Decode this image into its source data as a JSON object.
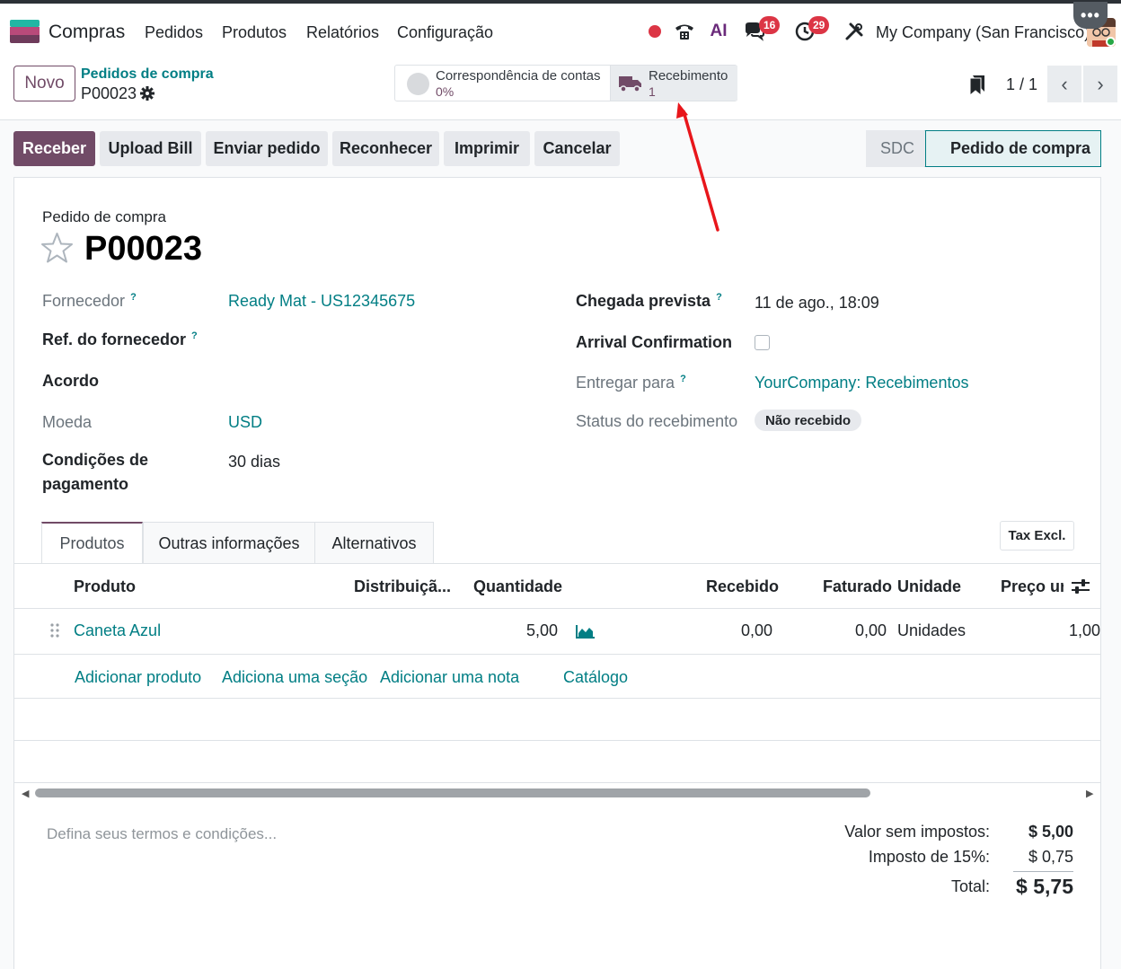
{
  "nav": {
    "app": "Compras",
    "menu": [
      "Pedidos",
      "Produtos",
      "Relatórios",
      "Configuração"
    ],
    "badges": {
      "messages": "16",
      "activities": "29"
    },
    "company": "My Company (San Francisco)",
    "ai_label": "AI"
  },
  "control": {
    "new_button": "Novo",
    "breadcrumb_parent": "Pedidos de compra",
    "breadcrumb_current": "P00023",
    "smart_match_title": "Correspondência de contas",
    "smart_match_value": "0%",
    "smart_receipt_title": "Recebimento",
    "smart_receipt_value": "1",
    "pager": "1 / 1"
  },
  "actions": {
    "buttons": [
      "Receber",
      "Upload Bill",
      "Enviar pedido",
      "Reconhecer",
      "Imprimir",
      "Cancelar"
    ],
    "status": [
      "SDC",
      "Pedido de compra"
    ]
  },
  "form": {
    "doc_label": "Pedido de compra",
    "doc_name": "P00023",
    "left": {
      "vendor_label": "Fornecedor",
      "vendor_value": "Ready Mat - US12345675",
      "vendor_ref_label": "Ref. do fornecedor",
      "agreement_label": "Acordo",
      "currency_label": "Moeda",
      "currency_value": "USD",
      "payment_terms_label_1": "Condições de",
      "payment_terms_label_2": "pagamento",
      "payment_terms_value": "30 dias"
    },
    "right": {
      "expected_label": "Chegada prevista",
      "expected_value": "11 de ago., 18:09",
      "arrival_confirm_label": "Arrival Confirmation",
      "deliver_to_label": "Entregar para",
      "deliver_to_value": "YourCompany: Recebimentos",
      "receipt_status_label": "Status do recebimento",
      "receipt_status_value": "Não recebido"
    },
    "help_mark": "?"
  },
  "tabs": [
    "Produtos",
    "Outras informações",
    "Alternativos"
  ],
  "tax_button": "Tax Excl.",
  "table": {
    "headers": [
      "Produto",
      "Distribuiçã...",
      "Quantidade",
      "Recebido",
      "Faturado",
      "Unidade",
      "Preço ur"
    ],
    "rows": [
      {
        "product": "Caneta Azul",
        "quantity": "5,00",
        "received": "0,00",
        "billed": "0,00",
        "unit": "Unidades",
        "price": "1,00"
      }
    ],
    "add_links": [
      "Adicionar produto",
      "Adiciona uma seção",
      "Adicionar uma nota",
      "Catálogo"
    ]
  },
  "footer": {
    "terms_placeholder": "Defina seus termos e condições...",
    "untaxed_label": "Valor sem impostos:",
    "untaxed_value": "$ 5,00",
    "tax_label": "Imposto de 15%:",
    "tax_value": "$ 0,75",
    "total_label": "Total:",
    "total_value": "$ 5,75"
  },
  "colors": {
    "brand": "#714b67",
    "link": "#017e84",
    "arrow": "#e8161b"
  }
}
